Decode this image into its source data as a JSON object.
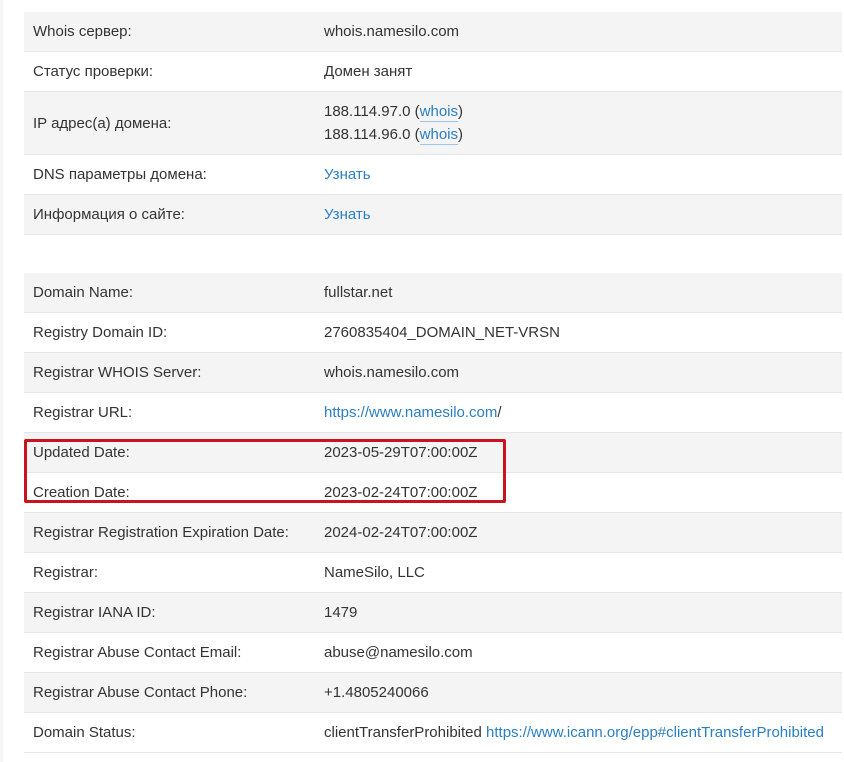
{
  "summary": {
    "whois_server": {
      "label": "Whois сервер:",
      "value": "whois.namesilo.com"
    },
    "check_status": {
      "label": "Статус проверки:",
      "value": "Домен занят"
    },
    "ip_addresses": {
      "label": "IP адрес(а) домена:",
      "items": [
        {
          "ip": "188.114.97.0",
          "open": " (",
          "link": "whois",
          "close": ")"
        },
        {
          "ip": "188.114.96.0",
          "open": " (",
          "link": "whois",
          "close": ")"
        }
      ]
    },
    "dns_params": {
      "label": "DNS параметры домена:",
      "link": "Узнать"
    },
    "site_info": {
      "label": "Информация о сайте:",
      "link": "Узнать"
    }
  },
  "whois": {
    "domain_name": {
      "label": "Domain Name:",
      "value": "fullstar.net"
    },
    "registry_domain_id": {
      "label": "Registry Domain ID:",
      "value": "2760835404_DOMAIN_NET-VRSN"
    },
    "registrar_whois_server": {
      "label": "Registrar WHOIS Server:",
      "value": "whois.namesilo.com"
    },
    "registrar_url": {
      "label": "Registrar URL:",
      "link": "https://www.namesilo.com",
      "suffix": "/"
    },
    "updated_date": {
      "label": "Updated Date:",
      "value": "2023-05-29T07:00:00Z"
    },
    "creation_date": {
      "label": "Creation Date:",
      "value": "2023-02-24T07:00:00Z"
    },
    "expiration_date": {
      "label": "Registrar Registration Expiration Date:",
      "value": "2024-02-24T07:00:00Z"
    },
    "registrar": {
      "label": "Registrar:",
      "value": "NameSilo, LLC"
    },
    "iana_id": {
      "label": "Registrar IANA ID:",
      "value": "1479"
    },
    "abuse_email": {
      "label": "Registrar Abuse Contact Email:",
      "value": "abuse@namesilo.com"
    },
    "abuse_phone": {
      "label": "Registrar Abuse Contact Phone:",
      "value": "+1.4805240066"
    },
    "domain_status": {
      "label": "Domain Status:",
      "value": "clientTransferProhibited",
      "link": "https://www.icann.org/epp#clientTransferProhibited"
    }
  },
  "highlight_color": "#c8141e",
  "link_color": "#2a7fc1"
}
